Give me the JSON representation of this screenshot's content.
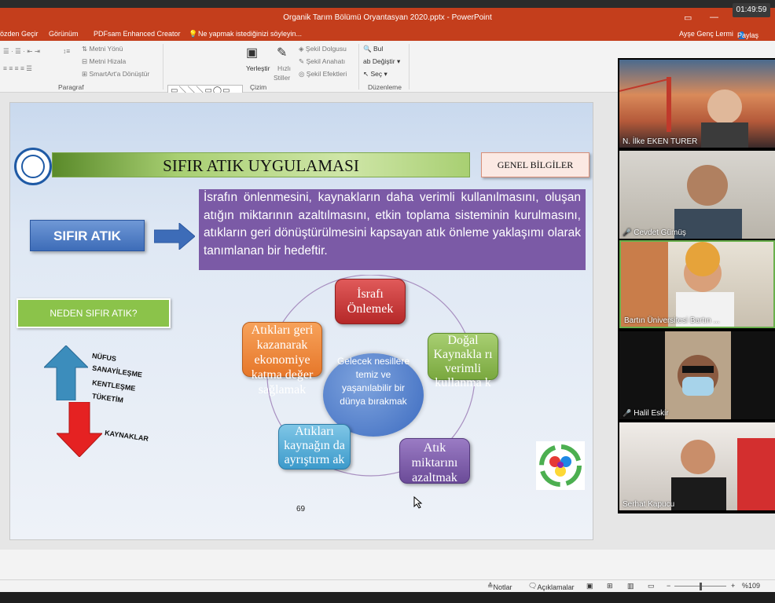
{
  "app": {
    "title": "Organik Tarım Bölümü Oryantasyan 2020.pptx - PowerPoint",
    "clock": "01:49:59",
    "user": "Ayşe Genç Lermi",
    "share": "Paylaş"
  },
  "menu": {
    "items": [
      "özden Geçir",
      "Görünüm",
      "PDFsam Enhanced Creator"
    ],
    "tell_me": "Ne yapmak istediğinizi söyleyin..."
  },
  "ribbon": {
    "paragraph_label": "Paragraf",
    "text_direction": "Metni Yönü",
    "align_text": "Metni Hizala",
    "smartart": "SmartArt'a Dönüştür",
    "drawing_label": "Çizim",
    "arrange": "Yerleştir",
    "quick_styles_1": "Hızlı",
    "quick_styles_2": "Stiller",
    "shape_fill": "Şekil Dolgusu",
    "shape_outline": "Şekil Anahatı",
    "shape_effects": "Şekil Efektleri",
    "find": "Bul",
    "replace": "Değiştir",
    "select": "Seç",
    "editing_label": "Düzenleme"
  },
  "slide": {
    "banner": "SIFIR ATIK UYGULAMASI",
    "genel": "GENEL BİLGİLER",
    "sifir_box": "SIFIR ATIK",
    "definition": "İsrafın önlenmesini, kaynakların daha verimli kullanılmasını, oluşan atığın miktarının azaltılmasını, etkin toplama sisteminin kurulmasını, atıkların geri dönüştürülmesini kapsayan atık önleme yaklaşımı olarak tanımlanan bir hedeftir.",
    "neden": "NEDEN SIFIR ATIK?",
    "side_labels": [
      "NÜFUS",
      "SANAYİLEŞME",
      "KENTLEŞME",
      "TÜKETİM"
    ],
    "kaynaklar": "KAYNAKLAR",
    "center": "Gelecek nesillere temiz ve yaşanılabilir bir dünya bırakmak",
    "nodes": {
      "israf": "İsrafı Önlemek",
      "dogal": "Doğal Kaynakla rı verimli kullanma k",
      "atik_miktar": "Atık miktarını azaltmak",
      "ayristir": "Atıkları kaynağın da ayrıştırm ak",
      "geri": "Atıkları geri kazanarak ekonomiye katma değer sağlamak"
    },
    "slide_number": "69"
  },
  "participants": [
    {
      "name": "N. İlke EKEN TURER",
      "muted": false
    },
    {
      "name": "Cevdet Gümüş",
      "muted": true
    },
    {
      "name": "Bartın Üniversitesi Bartın ...",
      "muted": false
    },
    {
      "name": "Halil Eskir",
      "muted": true
    },
    {
      "name": "Serhat Kapucu",
      "muted": false
    }
  ],
  "status": {
    "notes": "Notlar",
    "comments": "Açıklamalar",
    "zoom": "%109"
  },
  "colors": {
    "ppt_red": "#c43e1c",
    "purple": "#7b5aa6",
    "green": "#8bc34a",
    "blue": "#3d6cb8",
    "active_speaker": "#6ab04c"
  }
}
